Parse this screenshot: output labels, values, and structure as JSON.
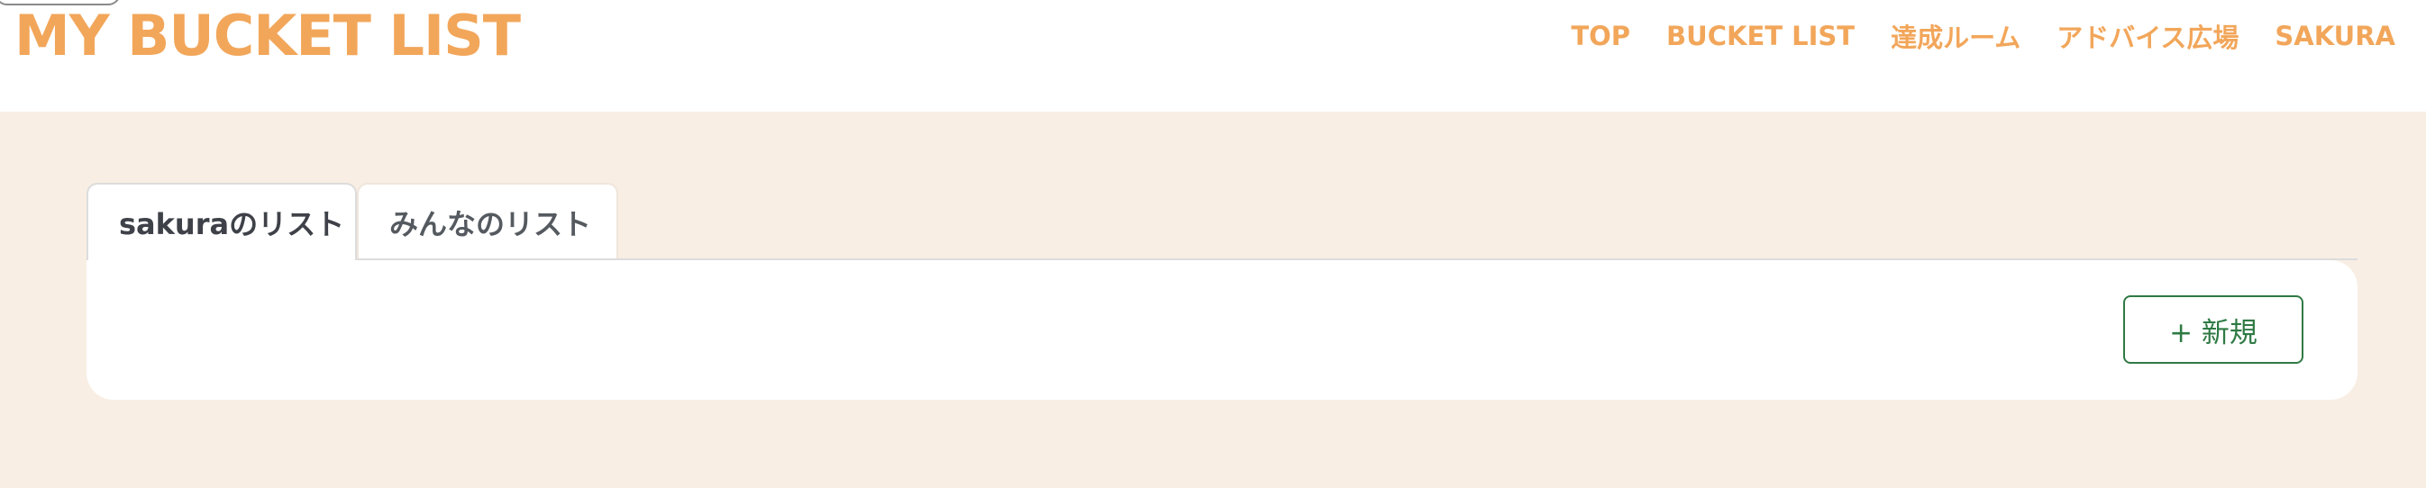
{
  "header": {
    "logo": "MY BUCKET LIST",
    "nav": [
      {
        "label": "TOP"
      },
      {
        "label": "BUCKET LIST"
      },
      {
        "label": "達成ルーム"
      },
      {
        "label": "アドバイス広場"
      },
      {
        "label": "SAKURA"
      }
    ]
  },
  "tabs": [
    {
      "label": "sakuraのリスト",
      "active": true
    },
    {
      "label": "みんなのリスト",
      "active": false
    }
  ],
  "panel": {
    "new_button_label": "+ 新規"
  },
  "colors": {
    "accent": "#f2a65a",
    "background": "#f8eee4",
    "button_green": "#2f7a44"
  }
}
